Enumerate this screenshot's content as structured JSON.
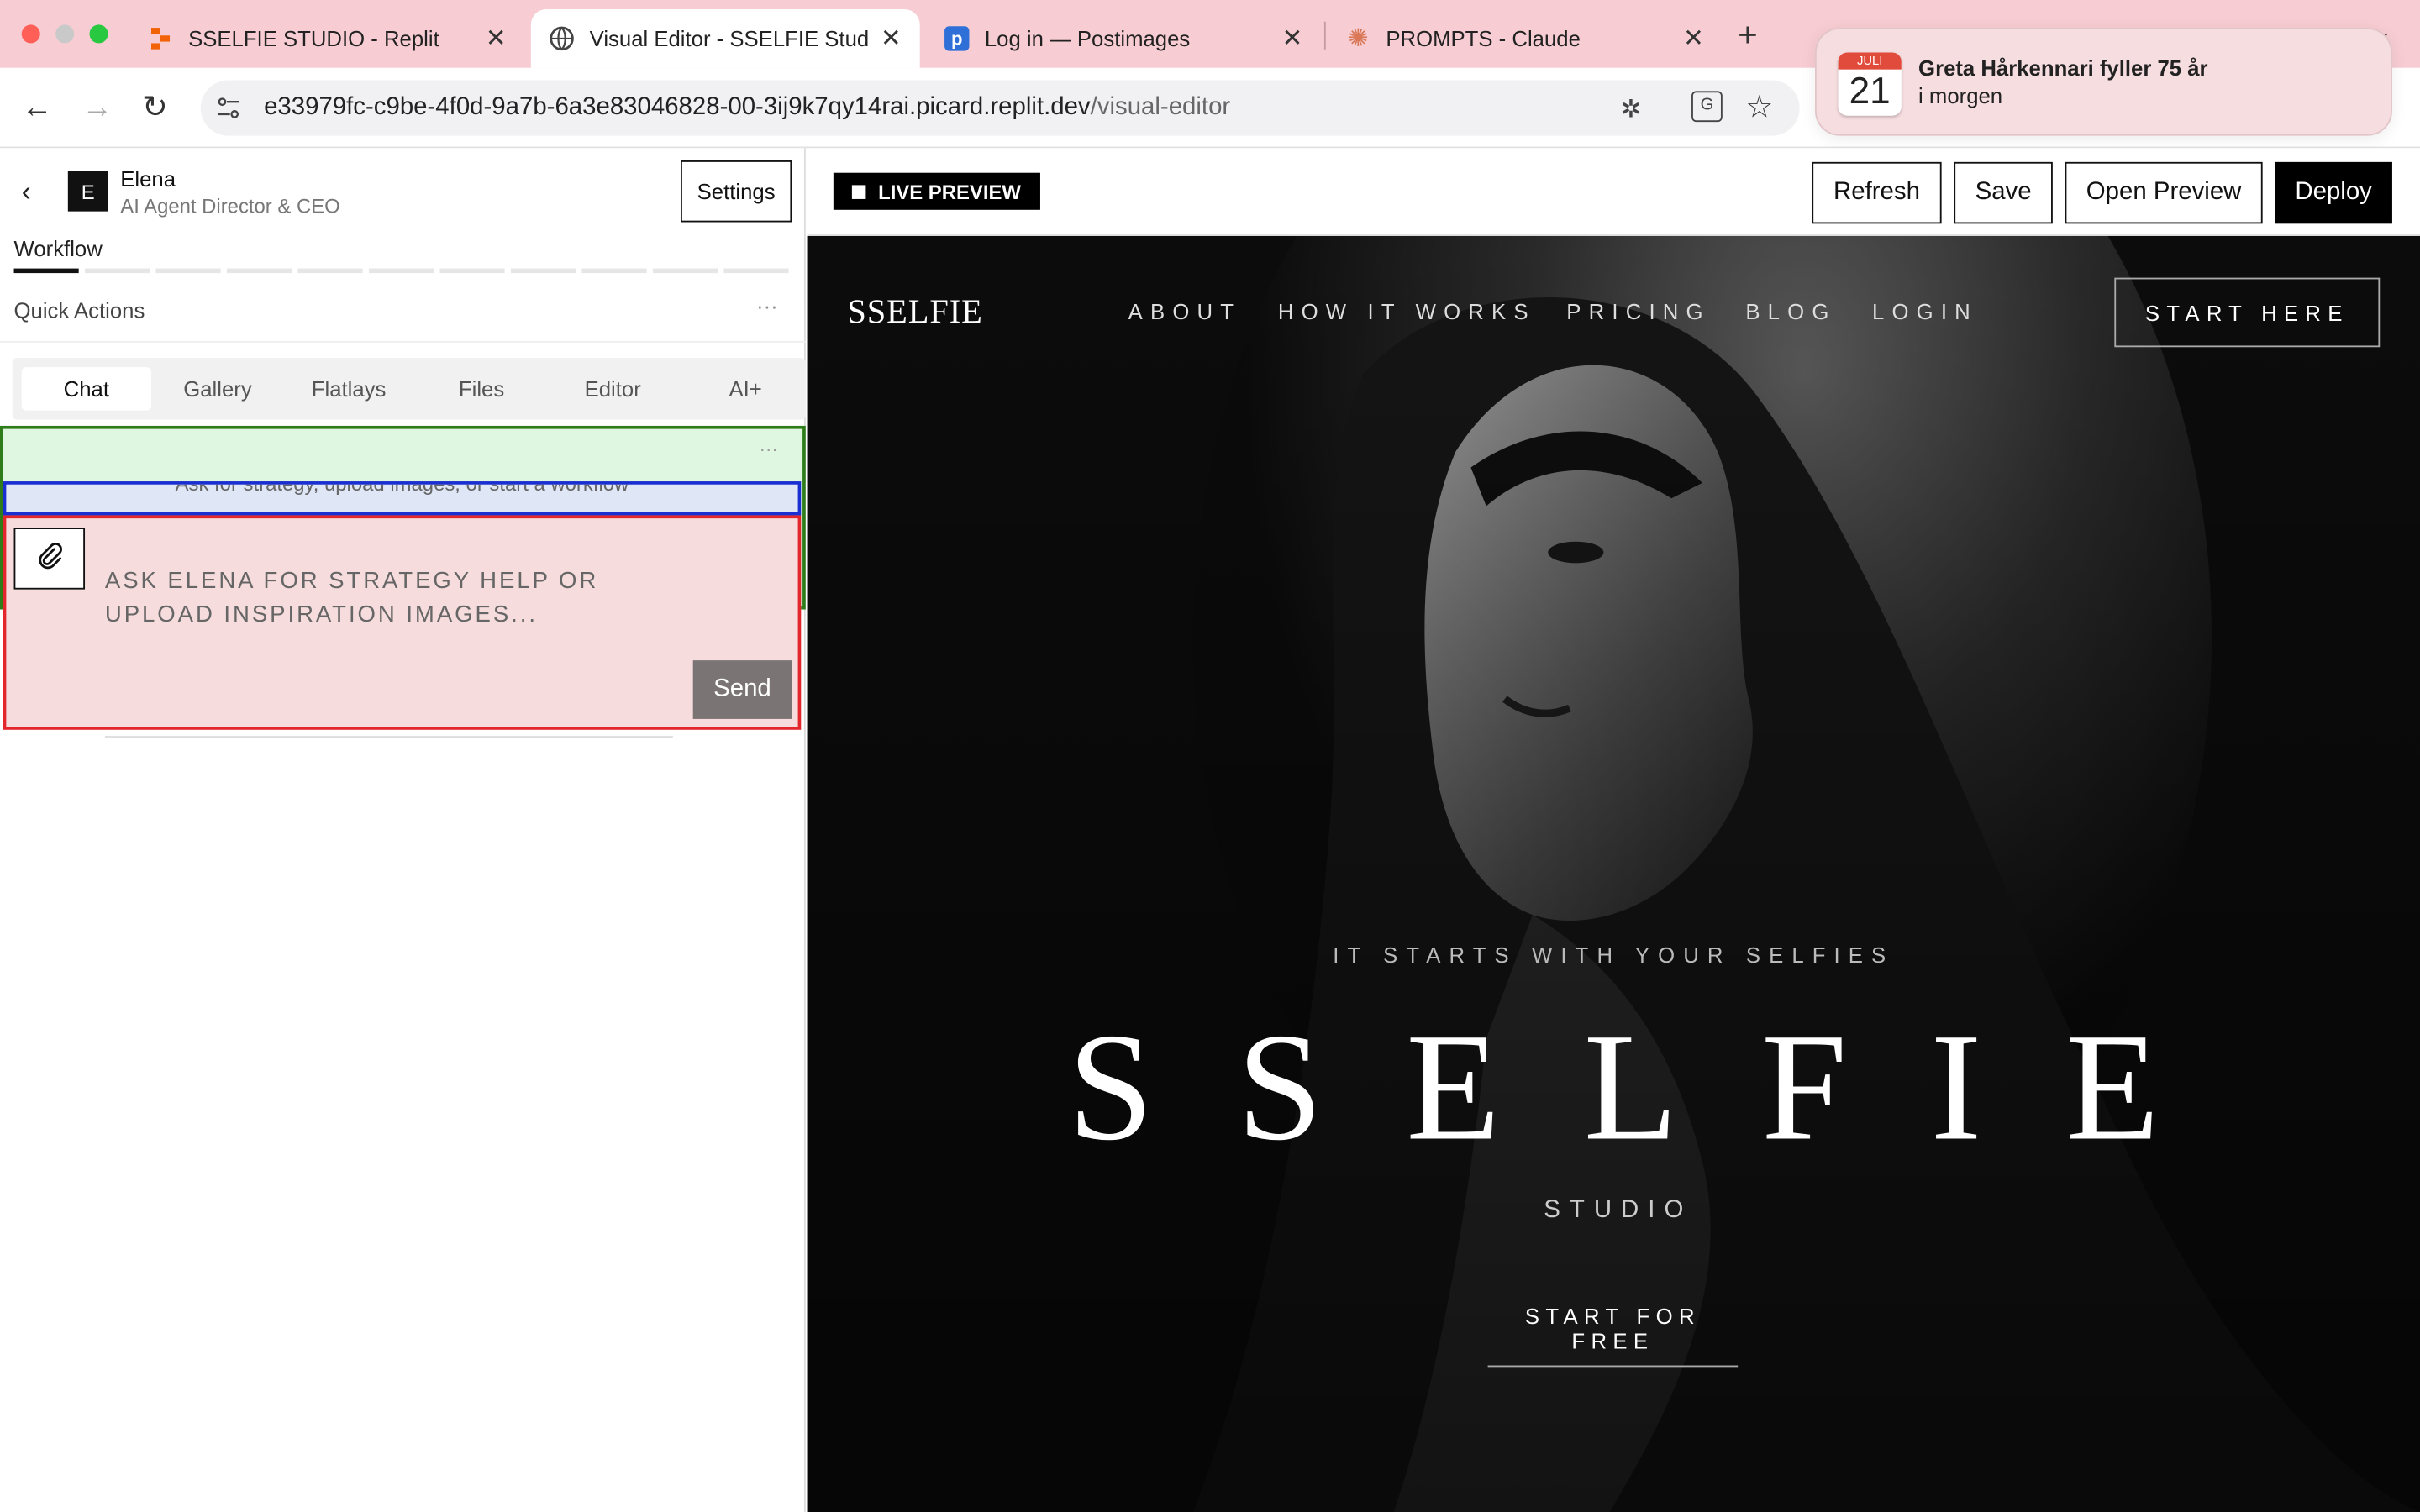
{
  "browser": {
    "tabs": [
      {
        "title": "SSELFIE STUDIO - Replit",
        "icon": "replit-icon"
      },
      {
        "title": "Visual Editor - SSELFIE Studio",
        "icon": "globe-icon"
      },
      {
        "title": "Log in — Postimages",
        "icon": "postimages-icon"
      },
      {
        "title": "PROMPTS - Claude",
        "icon": "claude-icon"
      }
    ],
    "new_tab": "+",
    "url_main": "e33979fc-c9be-4f0d-9a7b-6a3e83046828-00-3ij9k7qy14rai.picard.replit.dev",
    "url_path": "/visual-editor"
  },
  "notification": {
    "month": "JULI",
    "day": "21",
    "title": "Greta Hårkennari fyller 75 år",
    "subtitle": "i morgen"
  },
  "left_panel": {
    "agent_initial": "E",
    "agent_name": "Elena",
    "agent_role": "AI Agent Director & CEO",
    "settings_label": "Settings",
    "workflow_label": "Workflow",
    "workflow_progress": 1,
    "workflow_steps": 11,
    "quick_actions_label": "Quick Actions",
    "more": "···",
    "tabs": [
      "Chat",
      "Gallery",
      "Flatlays",
      "Files",
      "Editor",
      "AI+"
    ],
    "active_tab": "Chat",
    "chat_hint": "Ask for strategy, upload images, or start a workflow",
    "message_placeholder": "ASK ELENA FOR STRATEGY HELP OR UPLOAD INSPIRATION IMAGES...",
    "send_label": "Send"
  },
  "editor_toolbar": {
    "live_preview": "LIVE PREVIEW",
    "refresh": "Refresh",
    "save": "Save",
    "open_preview": "Open Preview",
    "deploy": "Deploy"
  },
  "site": {
    "logo": "SSELFIE",
    "nav": [
      "ABOUT",
      "HOW IT WORKS",
      "PRICING",
      "BLOG",
      "LOGIN"
    ],
    "cta": "START HERE",
    "eyebrow": "IT STARTS WITH YOUR SELFIES",
    "hero_title": "SSELFIE",
    "hero_subtitle": "STUDIO",
    "hero_cta": "START FOR FREE"
  },
  "colors": {
    "tab_strip": "#f7cdd3",
    "selection_green": "#2e7d1a",
    "selection_blue": "#1a2fd1",
    "selection_red": "#e3262b",
    "send_button": "#7a7474"
  }
}
